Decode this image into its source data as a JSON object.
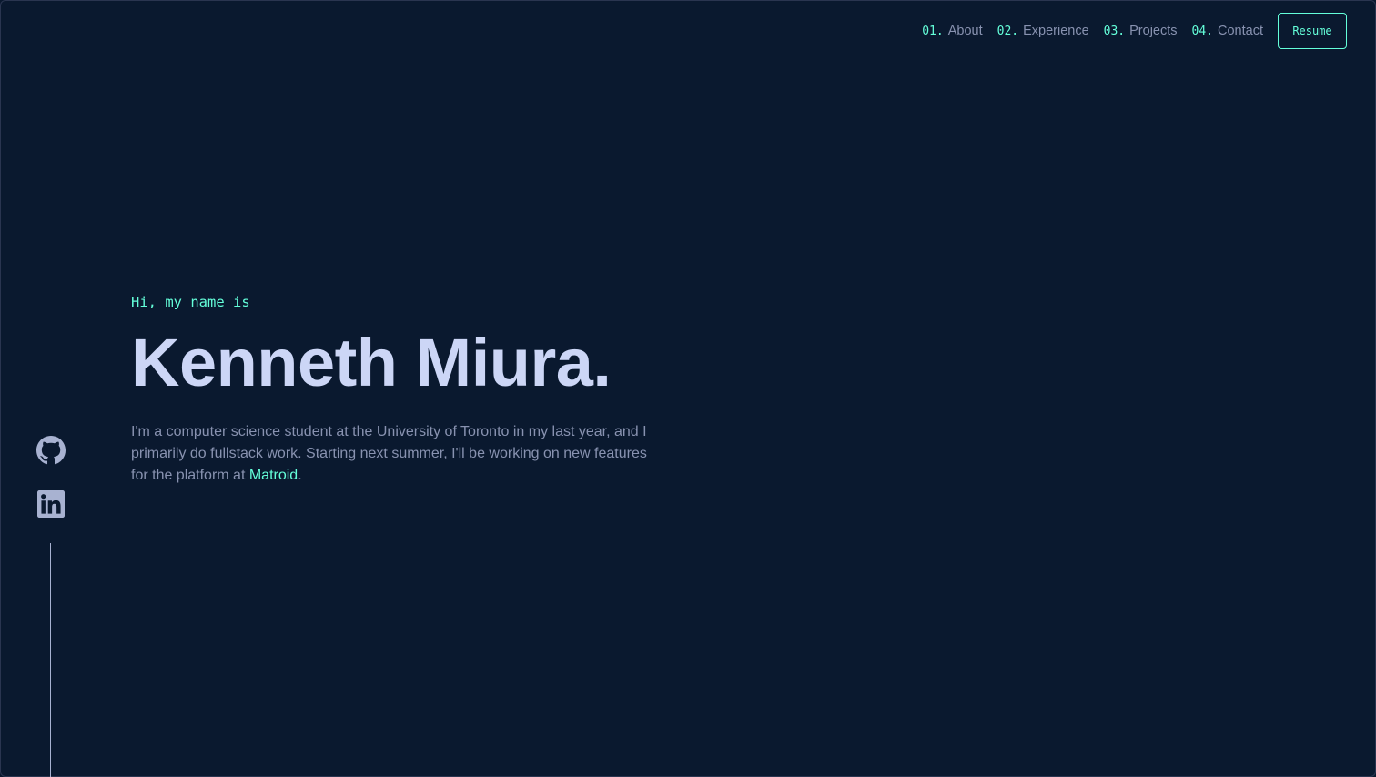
{
  "nav": {
    "items": [
      {
        "num": "01.",
        "label": "About"
      },
      {
        "num": "02.",
        "label": "Experience"
      },
      {
        "num": "03.",
        "label": "Projects"
      },
      {
        "num": "04.",
        "label": "Contact"
      }
    ],
    "resume_label": "Resume"
  },
  "hero": {
    "greeting": "Hi, my name is",
    "name": "Kenneth Miura.",
    "bio_prefix": "I'm a computer science student at the University of Toronto in my last year, and I primarily do fullstack work. Starting next summer, I'll be working on new features for the platform at ",
    "bio_link": "Matroid",
    "bio_suffix": "."
  },
  "social": {
    "icons": [
      "github-icon",
      "linkedin-icon"
    ]
  },
  "colors": {
    "background": "#0a192f",
    "accent": "#64ffda",
    "heading": "#ccd6f6",
    "text": "#8892b0"
  }
}
